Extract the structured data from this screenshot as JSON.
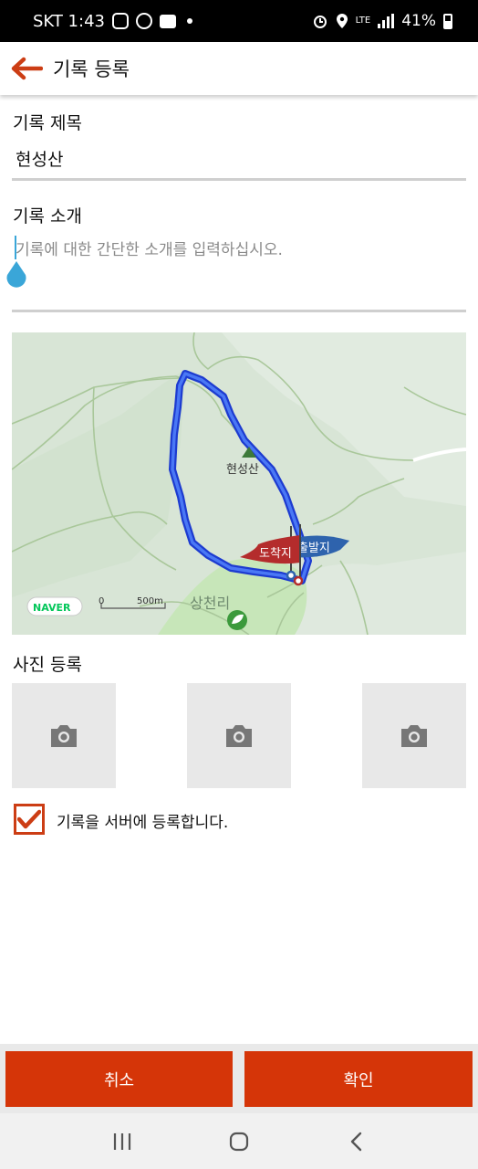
{
  "status_bar": {
    "carrier_time": "SKT 1:43",
    "network": "LTE",
    "battery": "41%"
  },
  "header": {
    "title": "기록 등록"
  },
  "form": {
    "title_label": "기록 제목",
    "title_value": "현성산",
    "intro_label": "기록 소개",
    "intro_placeholder": "기록에 대한 간단한 소개를 입력하십시오."
  },
  "map": {
    "peak_label": "현성산",
    "village_label": "상천리",
    "end_flag_label": "도착지",
    "start_flag_label": "출발지",
    "brand": "NAVER",
    "scale_zero": "0",
    "scale_label": "500m",
    "route_color": "#2d4fe6",
    "end_flag_color": "#b42c2c",
    "start_flag_color": "#2e63ad"
  },
  "photos": {
    "label": "사진 등록",
    "slots": [
      "camera-icon",
      "camera-icon",
      "camera-icon"
    ]
  },
  "save_to_server": {
    "checked": true,
    "label": "기록을 서버에 등록합니다."
  },
  "actions": {
    "cancel_label": "취소",
    "confirm_label": "확인",
    "accent_color": "#d53508"
  }
}
